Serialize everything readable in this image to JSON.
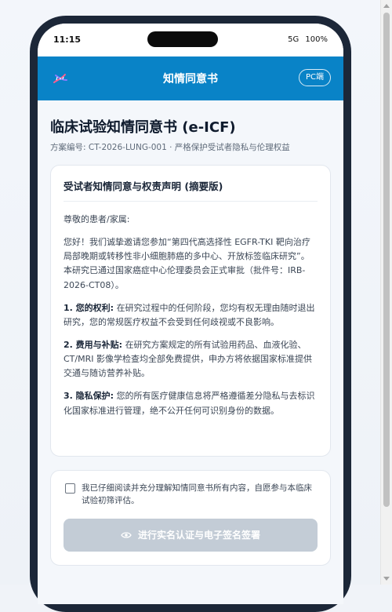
{
  "status_bar": {
    "time": "11:15",
    "network": "5G",
    "battery": "100%"
  },
  "header": {
    "logo_icon": "dna-icon",
    "title": "知情同意书",
    "pc_button": "PC端"
  },
  "document": {
    "title": "临床试验知情同意书 (e-ICF)",
    "subtitle": "方案编号: CT-2026-LUNG-001 · 严格保护受试者隐私与伦理权益"
  },
  "statement_card": {
    "title": "受试者知情同意与权责声明 (摘要版)",
    "greeting": "尊敬的患者/家属:",
    "intro": "您好！我们诚挚邀请您参加“第四代高选择性 EGFR-TKI 靶向治疗局部晚期或转移性非小细胞肺癌的多中心、开放标签临床研究”。本研究已通过国家癌症中心伦理委员会正式审批（批件号：IRB-2026-CT08）。",
    "items": [
      {
        "label": "1. 您的权利:",
        "text": "在研究过程中的任何阶段，您均有权无理由随时退出研究，您的常规医疗权益不会受到任何歧视或不良影响。"
      },
      {
        "label": "2. 费用与补贴:",
        "text": "在研究方案规定的所有试验用药品、血液化验、CT/MRI 影像学检查均全部免费提供，申办方将依据国家标准提供交通与随访营养补贴。"
      },
      {
        "label": "3. 隐私保护:",
        "text": "您的所有医疗健康信息将严格遵循差分隐私与去标识化国家标准进行管理，绝不公开任何可识别身份的数据。"
      }
    ]
  },
  "consent": {
    "checked": false,
    "text": "我已仔细阅读并充分理解知情同意书所有内容，自愿参与本临床试验初筛评估。",
    "button_label": "进行实名认证与电子签名签署",
    "button_icon": "eye-icon"
  },
  "colors": {
    "header_bg": "#0983c7",
    "button_disabled": "#c3ccd6"
  }
}
